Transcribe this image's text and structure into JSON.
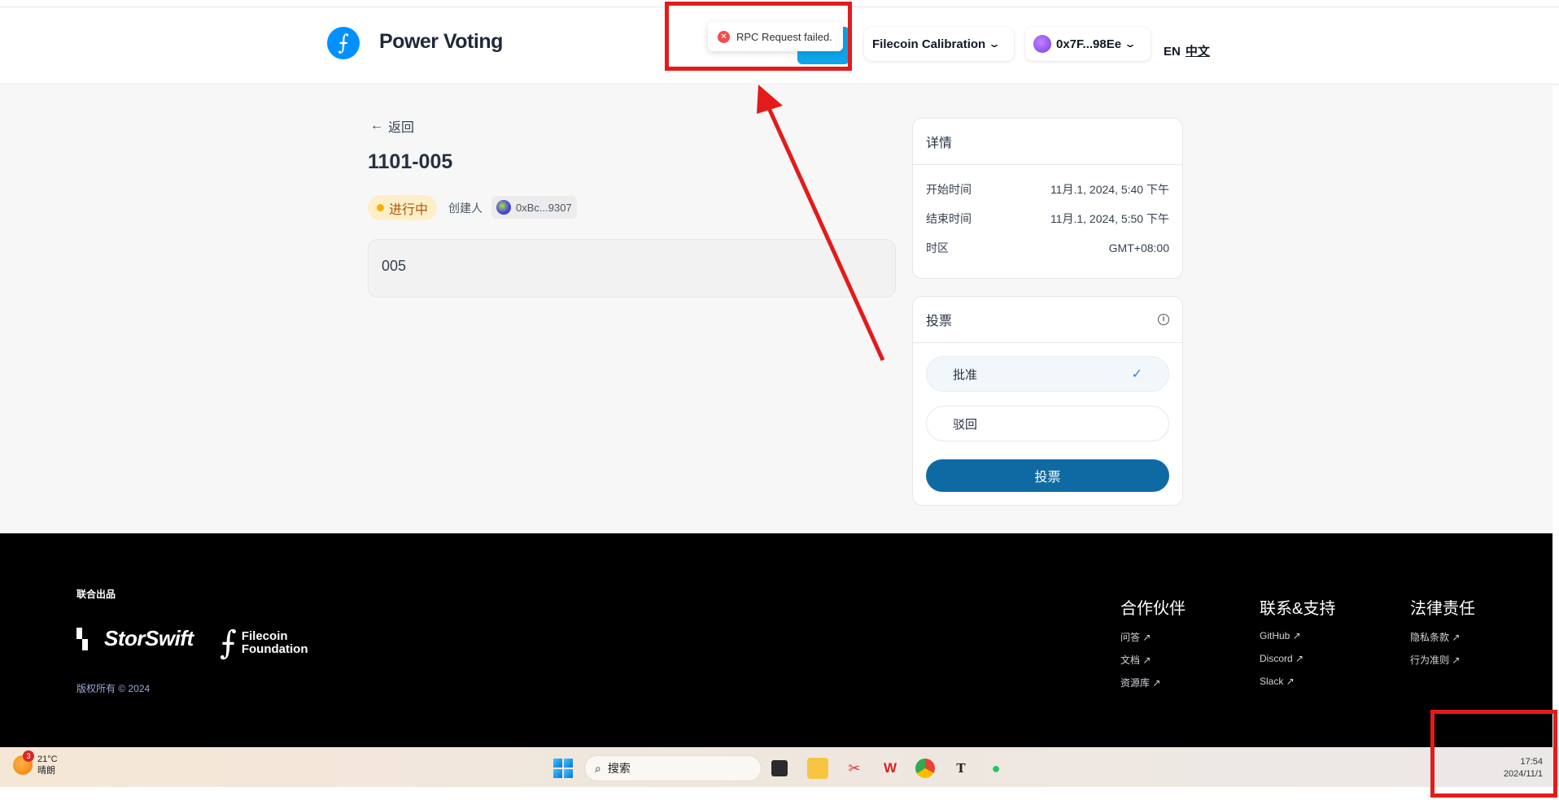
{
  "header": {
    "brand": "Power Voting",
    "network": "Filecoin Calibration",
    "account": "0x7F...98Ee",
    "lang_en": "EN",
    "lang_zh": "中文"
  },
  "toast": {
    "message": "RPC Request failed."
  },
  "proposal": {
    "back_label": "返回",
    "title": "1101-005",
    "status": "进行中",
    "creator_label": "创建人",
    "creator_address": "0xBc...9307",
    "content": "005"
  },
  "details": {
    "heading": "详情",
    "rows": [
      {
        "label": "开始时间",
        "value": "11月.1, 2024, 5:40 下午"
      },
      {
        "label": "结束时间",
        "value": "11月.1, 2024, 5:50 下午"
      },
      {
        "label": "时区",
        "value": "GMT+08:00"
      }
    ]
  },
  "vote": {
    "heading": "投票",
    "options": [
      "批准",
      "驳回"
    ],
    "selected": "批准",
    "submit": "投票"
  },
  "footer": {
    "produced_by": "联合出品",
    "partner1": "StorSwift",
    "partner2_line1": "Filecoin",
    "partner2_line2": "Foundation",
    "copyright": "版权所有 © 2024",
    "columns": [
      {
        "title": "合作伙伴",
        "links": [
          "问答 ↗",
          "文档 ↗",
          "资源库 ↗"
        ]
      },
      {
        "title": "联系&支持",
        "links": [
          "GitHub ↗",
          "Discord ↗",
          "Slack ↗"
        ]
      },
      {
        "title": "法律责任",
        "links": [
          "隐私条款 ↗",
          "行为准则 ↗"
        ]
      }
    ]
  },
  "taskbar": {
    "weather_badge": "3",
    "temperature": "21°C",
    "condition": "晴朗",
    "search_placeholder": "搜索",
    "time": "17:54",
    "date": "2024/11/1"
  }
}
